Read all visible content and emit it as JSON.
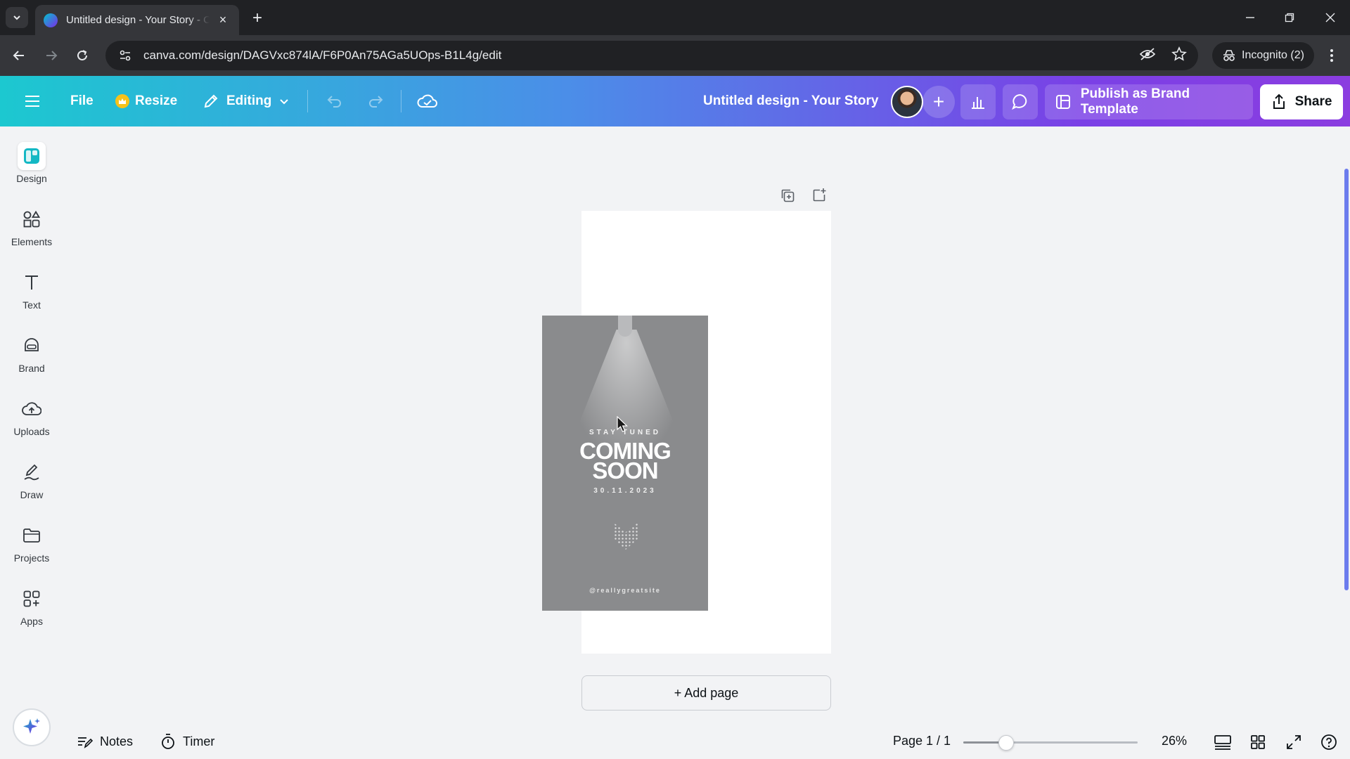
{
  "browser": {
    "tab_title": "Untitled design - Your Story - Canva",
    "url": "canva.com/design/DAGVxc874lA/F6P0An75AGa5UOps-B1L4g/edit",
    "incognito_label": "Incognito (2)"
  },
  "header": {
    "file": "File",
    "resize": "Resize",
    "editing": "Editing",
    "design_title": "Untitled design - Your Story",
    "publish": "Publish as Brand Template",
    "share": "Share"
  },
  "sidebar": {
    "items": [
      {
        "label": "Design",
        "icon": "design-icon"
      },
      {
        "label": "Elements",
        "icon": "elements-icon"
      },
      {
        "label": "Text",
        "icon": "text-icon"
      },
      {
        "label": "Brand",
        "icon": "brand-icon"
      },
      {
        "label": "Uploads",
        "icon": "uploads-icon"
      },
      {
        "label": "Draw",
        "icon": "draw-icon"
      },
      {
        "label": "Projects",
        "icon": "projects-icon"
      },
      {
        "label": "Apps",
        "icon": "apps-icon"
      }
    ]
  },
  "poster": {
    "stay": "STAY TUNED",
    "coming": "COMING",
    "soon": "SOON",
    "date": "30.11.2023",
    "handle": "@reallygreatsite"
  },
  "canvas": {
    "add_page": "+ Add page"
  },
  "footer": {
    "notes": "Notes",
    "timer": "Timer",
    "page_info": "Page 1 / 1",
    "zoom_label": "26%",
    "zoom_level": 0.26
  },
  "colors": {
    "header_start": "#1cc8d0",
    "header_end": "#8b3de0",
    "page_bg": "#f2f3f5"
  }
}
